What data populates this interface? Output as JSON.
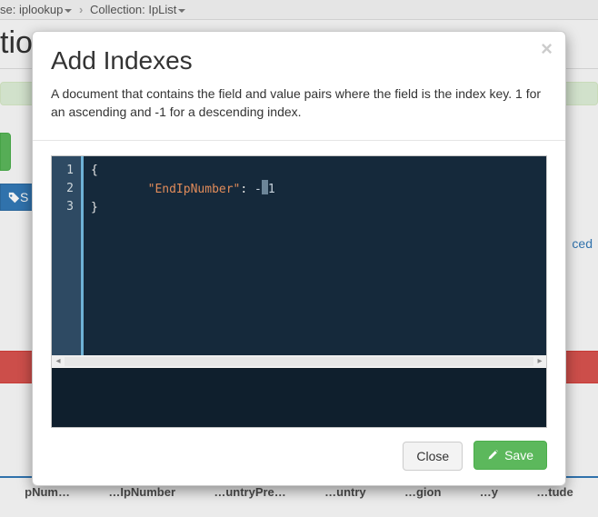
{
  "breadcrumb": {
    "db_label_prefix": "se:",
    "db_name": "iplookup",
    "collection_label": "Collection:",
    "collection_name": "IpList"
  },
  "page": {
    "title_fragment": "tio",
    "tag_button_text_fragment": "S",
    "link_fragment": "ced"
  },
  "columns": [
    "pNum…",
    "…IpNumber",
    "…untryPre…",
    "…untry",
    "…gion",
    "…y",
    "…tude"
  ],
  "modal": {
    "title": "Add Indexes",
    "subtitle": "A document that contains the field and value pairs where the field is the index key. 1 for an ascending and -1 for a descending index.",
    "close_btn": "Close",
    "save_btn": "Save"
  },
  "editor": {
    "line_numbers": [
      "1",
      "2",
      "3"
    ],
    "code": {
      "key": "\"EndIpNumber\"",
      "value": "-1",
      "open": "{",
      "close": "}",
      "colon": ": "
    }
  }
}
